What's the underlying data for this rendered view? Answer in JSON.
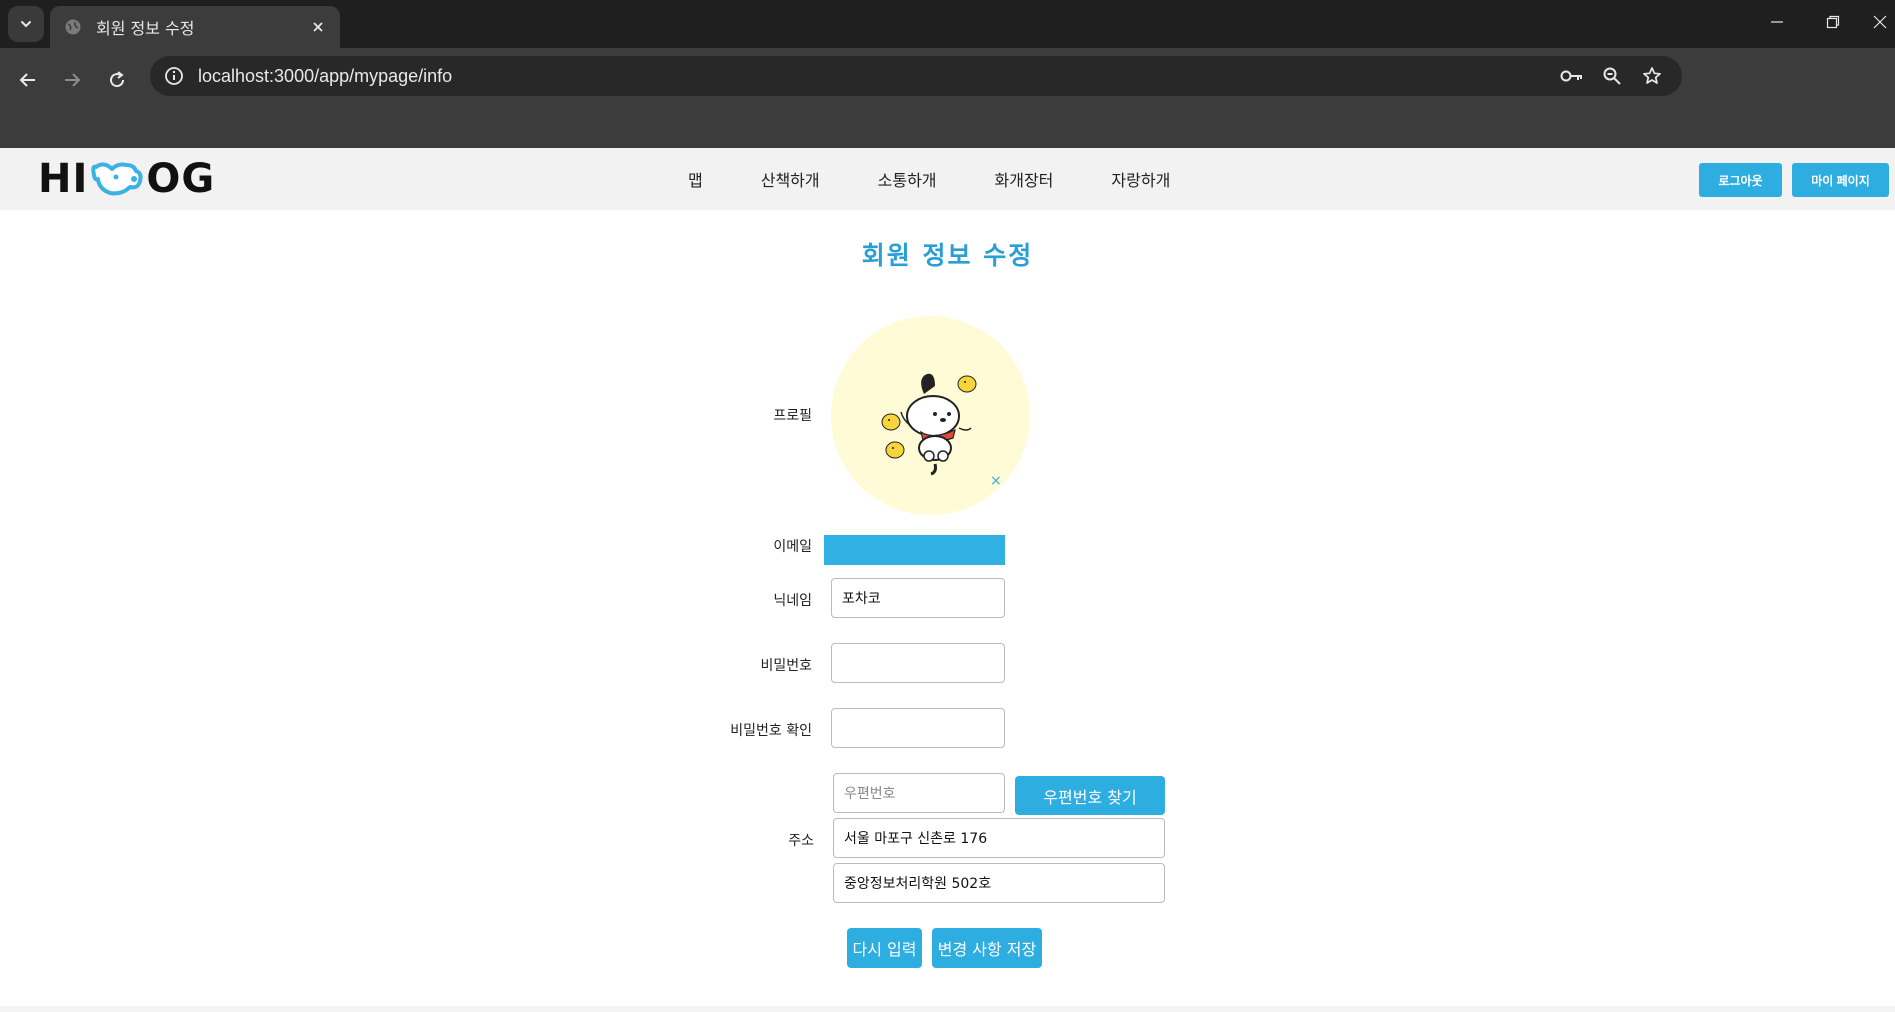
{
  "browser": {
    "tab_title": "회원 정보 수정",
    "url": "localhost:3000/app/mypage/info"
  },
  "header": {
    "logo_left": "HI",
    "logo_right": "OG",
    "nav": [
      "맵",
      "산책하개",
      "소통하개",
      "화개장터",
      "자랑하개"
    ],
    "logout_label": "로그아웃",
    "mypage_label": "마이 페이지"
  },
  "form": {
    "title": "회원 정보 수정",
    "profile_label": "프로필",
    "profile_remove": "×",
    "email_label": "이메일",
    "nickname_label": "닉네임",
    "nickname_value": "포차코",
    "password_label": "비밀번호",
    "password_confirm_label": "비밀번호 확인",
    "address_label": "주소",
    "postcode_placeholder": "우편번호",
    "postcode_button": "우편번호 찾기",
    "address_value": "서울 마포구 신촌로 176",
    "address_detail_value": "중앙정보처리학원 502호",
    "reset_button": "다시 입력",
    "save_button": "변경 사항 저장"
  },
  "colors": {
    "accent": "#2eaee0",
    "title": "#2a9fd6",
    "profile_bg": "#fffbd6"
  },
  "icons": {
    "tab_search": "chevron-down-icon",
    "favicon": "globe-icon",
    "back": "back-arrow-icon",
    "forward": "forward-arrow-icon",
    "reload": "reload-icon",
    "site_info": "info-icon",
    "password_key": "key-icon",
    "zoom": "zoom-icon",
    "bookmark": "star-icon"
  }
}
